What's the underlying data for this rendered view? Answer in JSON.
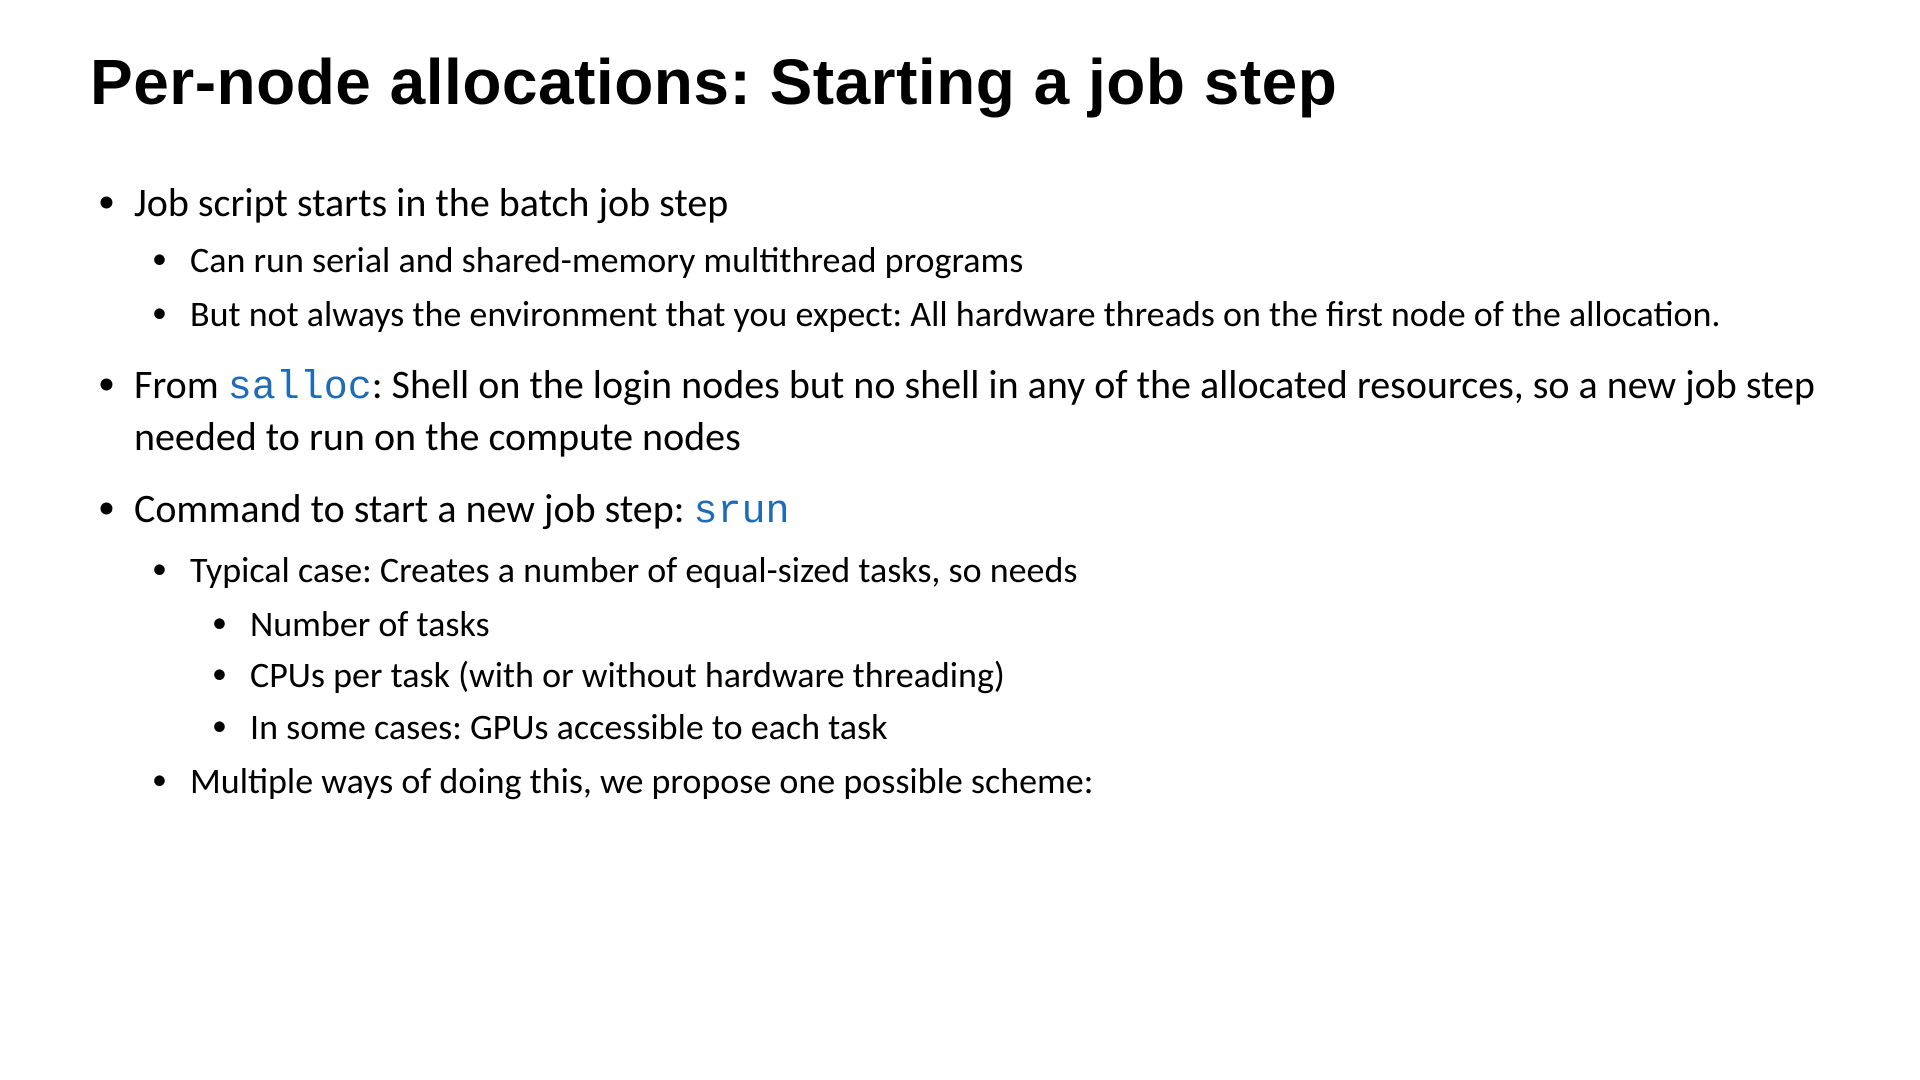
{
  "slide": {
    "title": "Per-node allocations: Starting a job step",
    "bullets": [
      {
        "text": "Job script starts in the batch job step",
        "children": [
          {
            "text": "Can run serial and shared-memory multithread programs"
          },
          {
            "text": "But not always the environment that you expect: All hardware threads on the first node of the allocation."
          }
        ]
      },
      {
        "prefix": "From ",
        "code": "salloc",
        "suffix": ": Shell on the login nodes but no shell in any of the allocated resources, so a new job step needed to run on the compute nodes"
      },
      {
        "prefix": "Command to start a new job step: ",
        "code": "srun",
        "children": [
          {
            "text": "Typical case: Creates a number of equal-sized tasks, so needs",
            "children": [
              {
                "text": "Number of tasks"
              },
              {
                "text": "CPUs per task (with or without hardware threading)"
              },
              {
                "text": "In some cases: GPUs accessible to each task"
              }
            ]
          },
          {
            "text": "Multiple ways of doing this, we propose one possible scheme:"
          }
        ]
      }
    ]
  }
}
